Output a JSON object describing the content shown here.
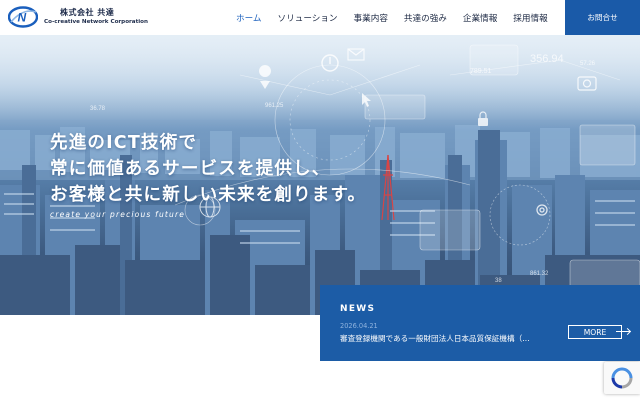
{
  "brand": {
    "name_jp": "株式会社 共達",
    "name_en": "Co-creative Network Corporation",
    "logo_letter": "N",
    "accent": "#1a5fbd"
  },
  "nav": {
    "items": [
      {
        "label": "ホーム",
        "active": true
      },
      {
        "label": "ソリューション",
        "active": false
      },
      {
        "label": "事業内容",
        "active": false
      },
      {
        "label": "共達の強み",
        "active": false
      },
      {
        "label": "企業情報",
        "active": false
      },
      {
        "label": "採用情報",
        "active": false
      }
    ],
    "contact_label": "お問合せ"
  },
  "hero": {
    "lines": [
      "先進のICT技術で",
      "常に価値あるサービスを提供し、",
      "お客様と共に新しい未来を創ります。"
    ],
    "subtitle": "create your precious future",
    "overlay_numbers": [
      "356.94",
      "789.51",
      "36.78",
      "57.26",
      "861.32",
      "38",
      "961.25"
    ]
  },
  "news": {
    "title": "NEWS",
    "date": "2026.04.21",
    "headline": "審査登録機関である一般財団法人日本品質保証機構（…",
    "more_label": "MORE",
    "color": "#1c5ca6"
  },
  "icons": [
    "logo-icon",
    "location-pin-icon",
    "power-icon",
    "mail-icon",
    "camera-icon",
    "lock-icon",
    "gear-icon",
    "globe-icon",
    "recaptcha-icon"
  ]
}
